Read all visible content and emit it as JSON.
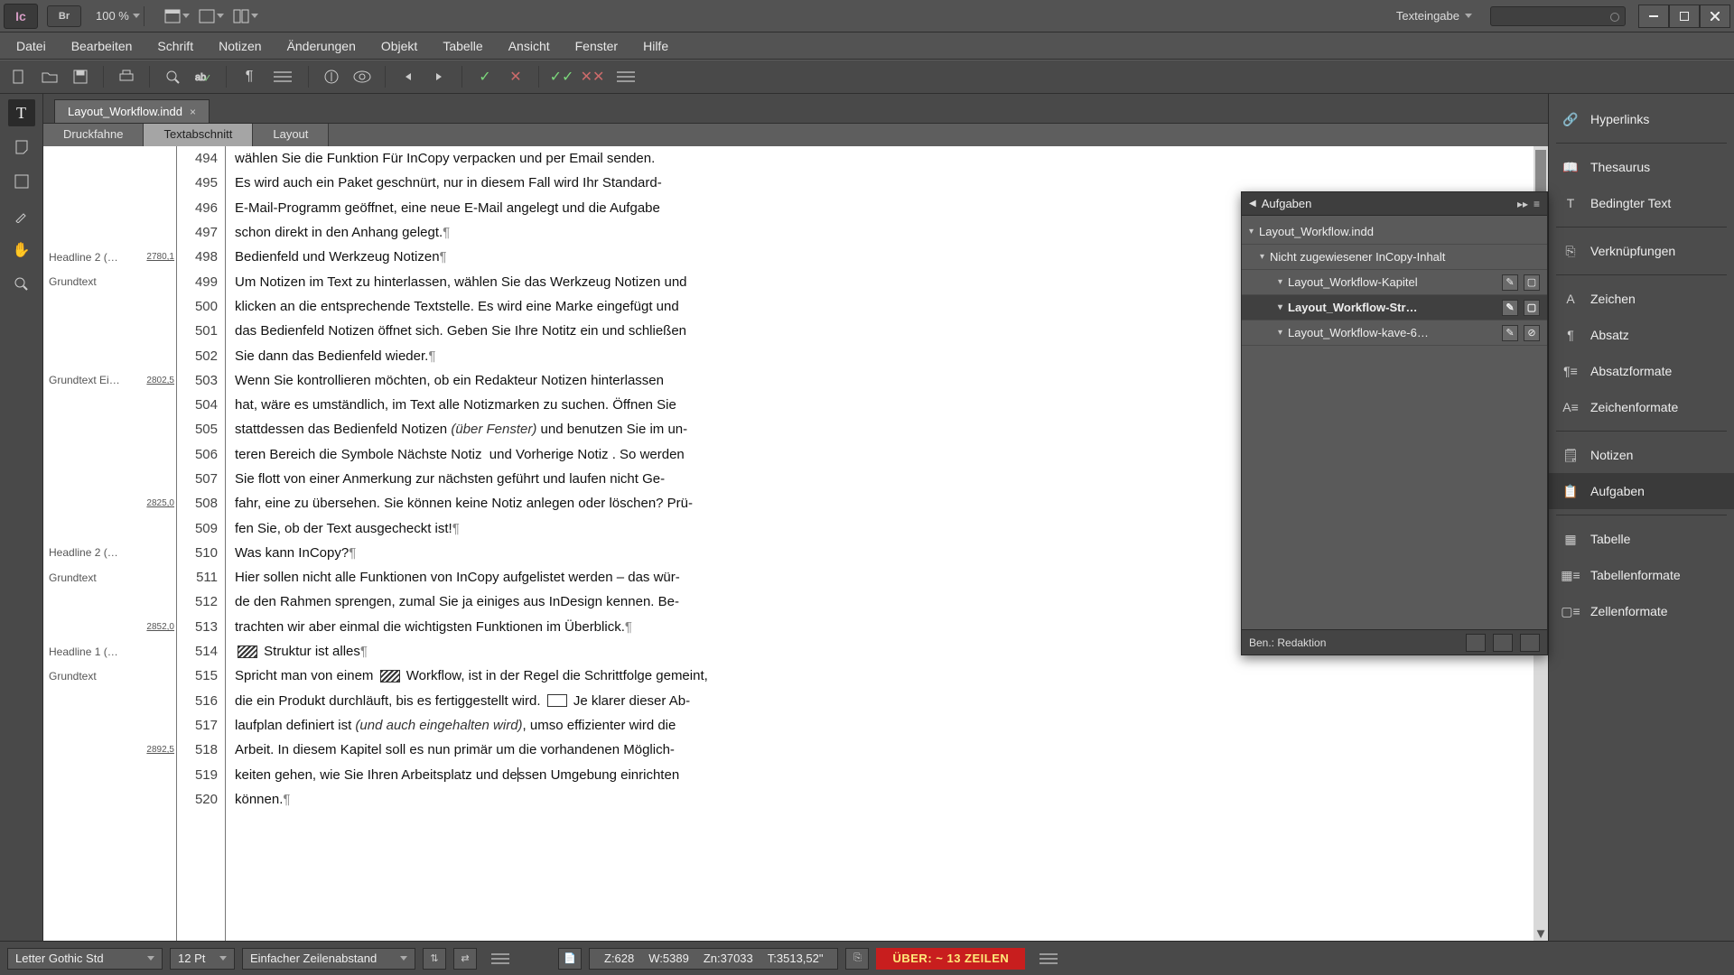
{
  "titlebar": {
    "logo": "Ic",
    "br": "Br",
    "zoom": "100 %",
    "mode": "Texteingabe"
  },
  "menu": {
    "items": [
      "Datei",
      "Bearbeiten",
      "Schrift",
      "Notizen",
      "Änderungen",
      "Objekt",
      "Tabelle",
      "Ansicht",
      "Fenster",
      "Hilfe"
    ]
  },
  "doc": {
    "tab": "Layout_Workflow.indd"
  },
  "viewtabs": {
    "items": [
      "Druckfahne",
      "Textabschnitt",
      "Layout"
    ],
    "active": 1
  },
  "lines": [
    {
      "n": 494,
      "style": "",
      "page": "",
      "t": "wählen Sie die Funktion Für InCopy verpacken und per Email senden."
    },
    {
      "n": 495,
      "style": "",
      "page": "",
      "t": "Es wird auch ein Paket geschnürt, nur in diesem Fall wird Ihr Standard-"
    },
    {
      "n": 496,
      "style": "",
      "page": "",
      "t": "E-Mail-Programm geöffnet, eine neue E-Mail angelegt und die Aufgabe"
    },
    {
      "n": 497,
      "style": "",
      "page": "",
      "t": "schon direkt in den Anhang gelegt.¶"
    },
    {
      "n": 498,
      "style": "Headline 2 (…",
      "page": "2780,1",
      "t": "Bedienfeld und Werkzeug Notizen¶"
    },
    {
      "n": 499,
      "style": "Grundtext",
      "page": "",
      "t": "Um Notizen im Text zu hinterlassen, wählen Sie das Werkzeug Notizen und"
    },
    {
      "n": 500,
      "style": "",
      "page": "",
      "t": "klicken an die entsprechende Textstelle. Es wird eine Marke eingefügt und"
    },
    {
      "n": 501,
      "style": "",
      "page": "",
      "t": "das Bedienfeld Notizen öffnet sich. Geben Sie Ihre Notitz ein und schließen"
    },
    {
      "n": 502,
      "style": "",
      "page": "",
      "t": "Sie dann das Bedienfeld wieder.¶"
    },
    {
      "n": 503,
      "style": "Grundtext Ei…",
      "page": "2802,5",
      "t": "Wenn Sie kontrollieren möchten, ob ein Redakteur Notizen hinterlassen"
    },
    {
      "n": 504,
      "style": "",
      "page": "",
      "t": "hat, wäre es umständlich, im Text alle Notizmarken zu suchen. Öffnen Sie"
    },
    {
      "n": 505,
      "style": "",
      "page": "",
      "t": "stattdessen das Bedienfeld Notizen <i>(über Fenster)</i> und benutzen Sie im un-"
    },
    {
      "n": 506,
      "style": "",
      "page": "",
      "t": "teren Bereich die Symbole Nächste Notiz  und Vorherige Notiz . So werden"
    },
    {
      "n": 507,
      "style": "",
      "page": "",
      "t": "Sie flott von einer Anmerkung zur nächsten geführt und laufen nicht Ge-"
    },
    {
      "n": 508,
      "style": "",
      "page": "2825,0",
      "t": "fahr, eine zu übersehen. Sie können keine Notiz anlegen oder löschen? Prü-"
    },
    {
      "n": 509,
      "style": "",
      "page": "",
      "t": "fen Sie, ob der Text ausgecheckt ist!¶"
    },
    {
      "n": 510,
      "style": "Headline 2 (…",
      "page": "",
      "t": "Was kann InCopy?¶"
    },
    {
      "n": 511,
      "style": "Grundtext",
      "page": "",
      "t": "Hier sollen nicht alle Funktionen von InCopy aufgelistet werden – das wür-"
    },
    {
      "n": 512,
      "style": "",
      "page": "",
      "t": "de den Rahmen sprengen, zumal Sie ja einiges aus InDesign kennen. Be-"
    },
    {
      "n": 513,
      "style": "",
      "page": "2852,0",
      "t": "trachten wir aber einmal die wichtigsten Funktionen im Überblick.¶"
    },
    {
      "n": 514,
      "style": "Headline 1 (…",
      "page": "",
      "t": "[ICON] Struktur ist alles¶"
    },
    {
      "n": 515,
      "style": "Grundtext",
      "page": "",
      "t": "Spricht man von einem [ICON] Workflow, ist in der Regel die Schrittfolge gemeint,"
    },
    {
      "n": 516,
      "style": "",
      "page": "",
      "t": "die ein Produkt durchläuft, bis es fertiggestellt wird. [ICON2] Je klarer dieser Ab-"
    },
    {
      "n": 517,
      "style": "",
      "page": "",
      "t": "laufplan definiert ist <i>(und auch eingehalten wird)</i>, umso effizienter wird die"
    },
    {
      "n": 518,
      "style": "",
      "page": "2892,5",
      "t": "Arbeit. In diesem Kapitel soll es nun primär um die vorhandenen Möglich-"
    },
    {
      "n": 519,
      "style": "",
      "page": "",
      "t": "keiten gehen, wie Sie Ihren Arbeitsplatz und de|ssen Umgebung einrichten"
    },
    {
      "n": 520,
      "style": "",
      "page": "",
      "t": "können.¶"
    }
  ],
  "aufgaben": {
    "title": "Aufgaben",
    "root": "Layout_Workflow.indd",
    "group": "Nicht zugewiesener InCopy-Inhalt",
    "items": [
      "Layout_Workflow-Kapitel",
      "Layout_Workflow-Str…",
      "Layout_Workflow-kave-6…"
    ],
    "selectedIndex": 1,
    "user_label": "Ben.: Redaktion"
  },
  "rightpanels": {
    "groups": [
      [
        "Hyperlinks"
      ],
      [
        "Thesaurus",
        "Bedingter Text"
      ],
      [
        "Verknüpfungen"
      ],
      [
        "Zeichen",
        "Absatz",
        "Absatzformate",
        "Zeichenformate"
      ],
      [
        "Notizen",
        "Aufgaben"
      ],
      [
        "Tabelle",
        "Tabellenformate",
        "Zellenformate"
      ]
    ],
    "active": "Aufgaben"
  },
  "status": {
    "font": "Letter Gothic Std",
    "size": "12 Pt",
    "leading": "Einfacher Zeilenabstand",
    "z": "Z:628",
    "w": "W:5389",
    "zn": "Zn:37033",
    "t": "T:3513,52\"",
    "overset": "ÜBER:  ~ 13 ZEILEN"
  }
}
